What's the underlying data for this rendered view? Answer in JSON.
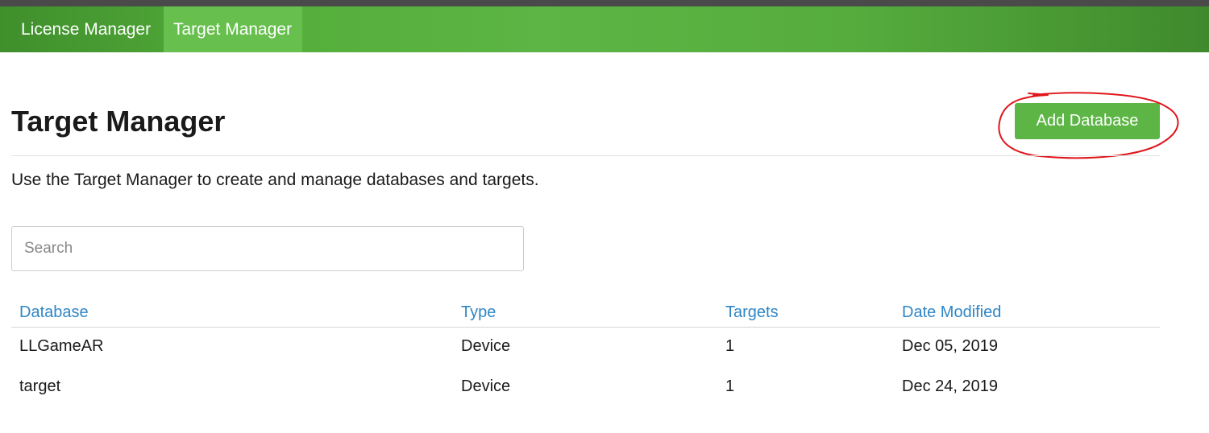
{
  "nav": {
    "items": [
      {
        "label": "License Manager"
      },
      {
        "label": "Target Manager",
        "active": true
      }
    ]
  },
  "header": {
    "title": "Target Manager",
    "add_button_label": "Add Database"
  },
  "description": "Use the Target Manager to create and manage databases and targets.",
  "search": {
    "placeholder": "Search",
    "value": ""
  },
  "table": {
    "columns": [
      "Database",
      "Type",
      "Targets",
      "Date Modified"
    ],
    "rows": [
      {
        "database": "LLGameAR",
        "type": "Device",
        "targets": "1",
        "date_modified": "Dec 05, 2019"
      },
      {
        "database": "target",
        "type": "Device",
        "targets": "1",
        "date_modified": "Dec 24, 2019"
      }
    ]
  },
  "colors": {
    "nav_green": "#5cb544",
    "nav_active": "#67bf4d",
    "button_green": "#5cb544",
    "link_blue": "#2f86c6",
    "annotation_red": "#e0161b"
  }
}
